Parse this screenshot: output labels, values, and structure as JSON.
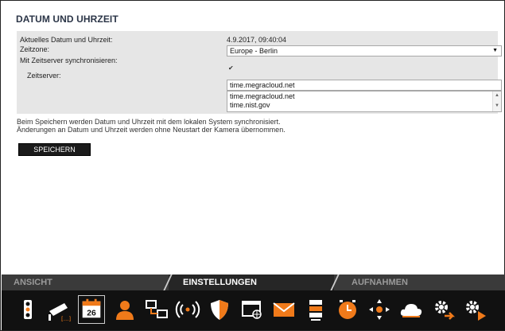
{
  "page": {
    "title": "DATUM UND UHRZEIT"
  },
  "settings": {
    "current_datetime_label": "Aktuelles Datum und Uhrzeit:",
    "current_datetime_value": "4.9.2017, 09:40:04",
    "timezone_label": "Zeitzone:",
    "timezone_value": "Europe - Berlin",
    "sync_label": "Mit Zeitserver synchronisieren:",
    "sync_checked": true,
    "timeserver_label": "Zeitserver:",
    "timeserver_value": "time.megracloud.net",
    "timeserver_options": [
      "time.megracloud.net",
      "time.nist.gov"
    ]
  },
  "note": {
    "line1": "Beim Speichern werden Datum und Uhrzeit mit dem lokalen System synchronisiert.",
    "line2": "Änderungen an Datum und Uhrzeit werden ohne Neustart der Kamera übernommen."
  },
  "buttons": {
    "save_label": "SPEICHERN"
  },
  "tabs": [
    {
      "label": "ANSICHT",
      "active": false
    },
    {
      "label": "EINSTELLUNGEN",
      "active": true
    },
    {
      "label": "AUFNAHMEN",
      "active": false
    }
  ],
  "toolbar": {
    "calendar_day": "26",
    "icons": [
      "traffic-light-icon",
      "camera-icon",
      "calendar-icon",
      "user-icon",
      "network-devices-icon",
      "wireless-signal-icon",
      "shield-icon",
      "web-browser-icon",
      "mail-icon",
      "storage-icon",
      "clock-icon",
      "ptz-control-icon",
      "cloud-icon",
      "gear-arrow-icon",
      "gear-play-icon"
    ]
  },
  "colors": {
    "accent": "#f07a1a",
    "tab_bar": "#3a3a3a",
    "icon_bar": "#111111",
    "section_bg": "#e6e6e6"
  }
}
